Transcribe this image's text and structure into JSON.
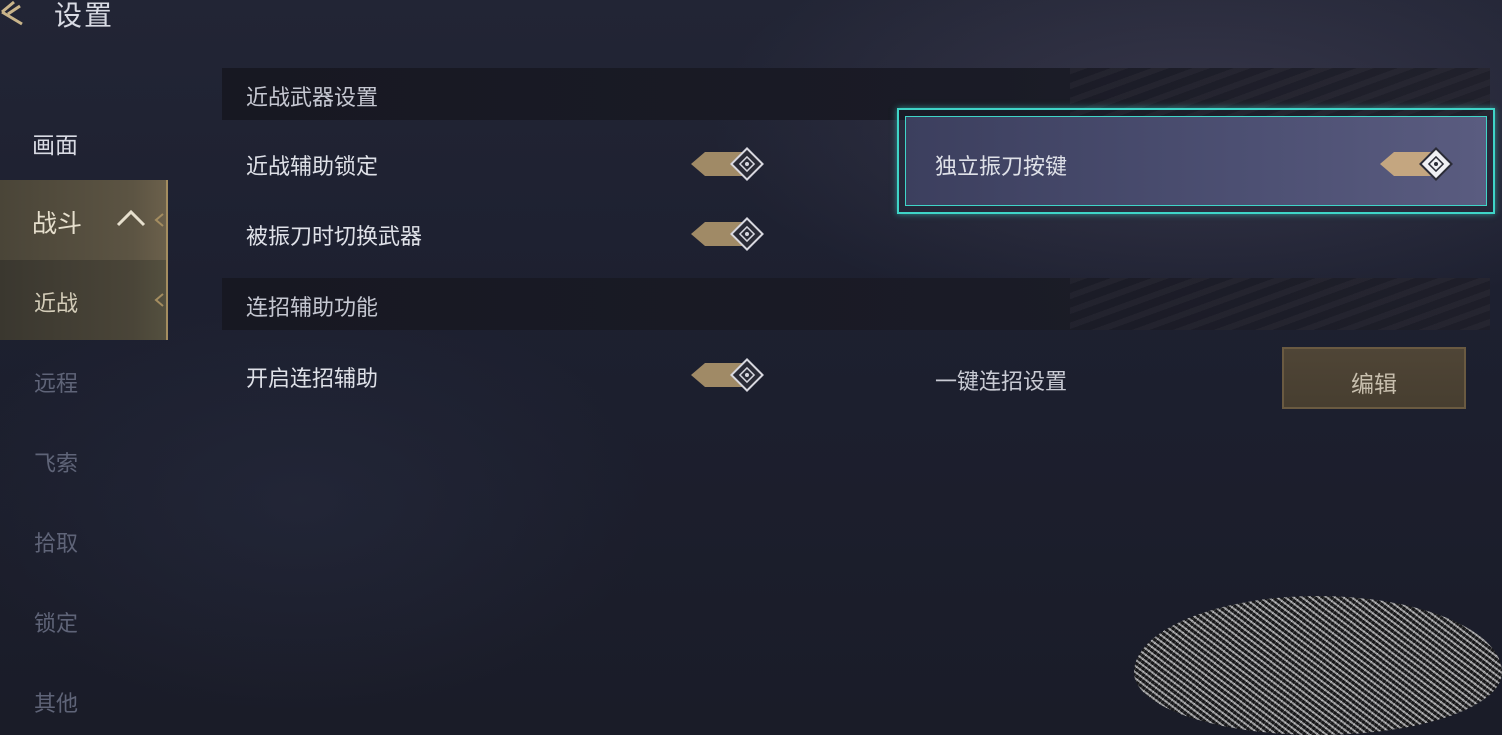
{
  "header": {
    "title": "设置"
  },
  "sidebar": {
    "items": [
      {
        "label": "画面"
      },
      {
        "label": "战斗"
      },
      {
        "label": "近战"
      },
      {
        "label": "远程"
      },
      {
        "label": "飞索"
      },
      {
        "label": "拾取"
      },
      {
        "label": "锁定"
      },
      {
        "label": "其他"
      }
    ]
  },
  "sections": [
    {
      "title": "近战武器设置",
      "rows": [
        {
          "label": "近战辅助锁定",
          "enabled": true
        },
        {
          "label": "被振刀时切换武器",
          "enabled": true
        },
        {
          "label": "独立振刀按键",
          "enabled": true
        }
      ]
    },
    {
      "title": "连招辅助功能",
      "rows": [
        {
          "label": "开启连招辅助",
          "enabled": true
        },
        {
          "label": "一键连招设置",
          "button": "编辑"
        }
      ]
    }
  ],
  "colors": {
    "accent_gold": "#a08a66",
    "focus_cyan": "#3fd5c8"
  }
}
